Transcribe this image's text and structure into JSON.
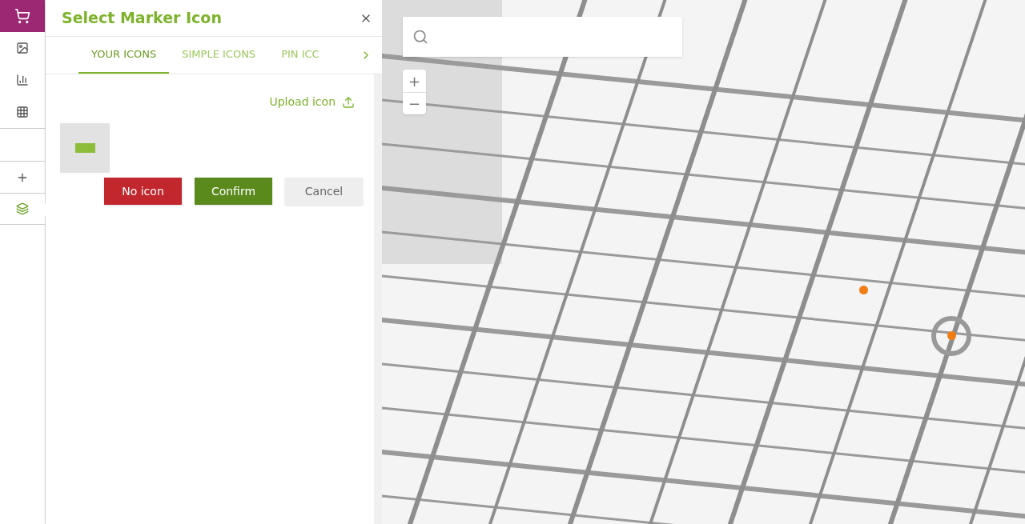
{
  "sidebar": {
    "items": [
      {
        "kind": "image",
        "selected": false
      },
      {
        "kind": "chart",
        "selected": false
      },
      {
        "kind": "grid",
        "selected": false
      },
      {
        "kind": "add",
        "selected": false
      },
      {
        "kind": "layers",
        "selected": true
      }
    ]
  },
  "dialog": {
    "title": "Select Marker Icon",
    "tabs": [
      {
        "label": "YOUR ICONS",
        "selected": true
      },
      {
        "label": "SIMPLE ICONS",
        "selected": false
      },
      {
        "label": "PIN ICC",
        "selected": false
      }
    ],
    "upload_link": "Upload icon",
    "buttons": [
      {
        "kind": "danger",
        "label": "No icon"
      },
      {
        "kind": "primary",
        "label": "Confirm"
      },
      {
        "kind": "secondary",
        "label": "Cancel"
      }
    ]
  },
  "map": {
    "zoom": [
      "+",
      "−"
    ]
  }
}
